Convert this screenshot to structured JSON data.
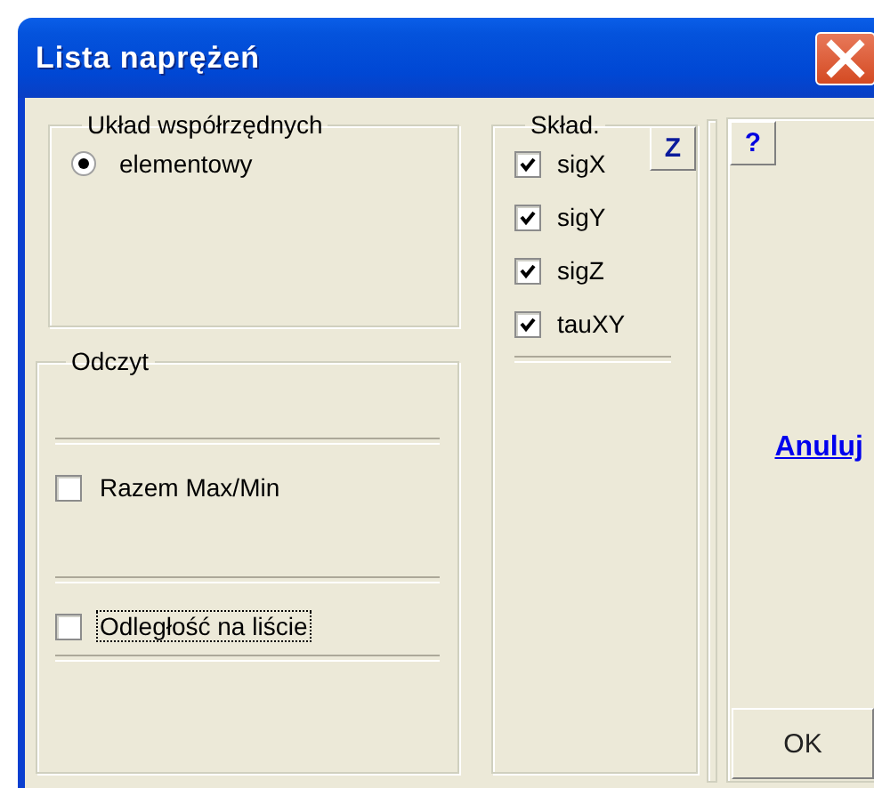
{
  "window": {
    "title": "Lista naprężeń"
  },
  "coordinate_system": {
    "title": "Układ współrzędnych",
    "options": [
      {
        "label": "elementowy",
        "selected": true
      }
    ]
  },
  "reading": {
    "title": "Odczyt",
    "options": [
      {
        "label": "Razem Max/Min",
        "checked": false,
        "focused": false
      },
      {
        "label": "Odległość na liście",
        "checked": false,
        "focused": true
      }
    ]
  },
  "components": {
    "title": "Skład.",
    "button": "Z",
    "items": [
      {
        "label": "sigX",
        "checked": true
      },
      {
        "label": "sigY",
        "checked": true
      },
      {
        "label": "sigZ",
        "checked": true
      },
      {
        "label": "tauXY",
        "checked": true
      }
    ]
  },
  "help_button": "?",
  "cancel_link": "Anuluj",
  "ok_button": "OK"
}
